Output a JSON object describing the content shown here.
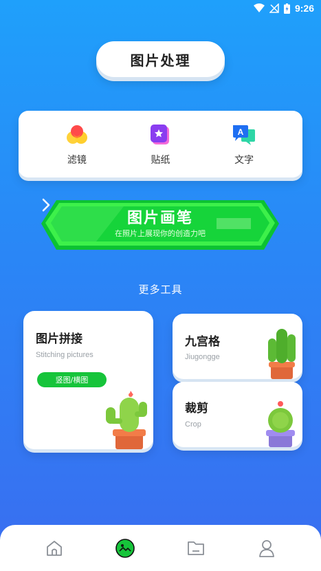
{
  "status": {
    "time": "9:26"
  },
  "header": {
    "title": "图片处理"
  },
  "tools": [
    {
      "label": "滤镜",
      "icon": "filter-icon"
    },
    {
      "label": "贴纸",
      "icon": "sticker-icon"
    },
    {
      "label": "文字",
      "icon": "text-icon"
    }
  ],
  "brush": {
    "title": "图片画笔",
    "subtitle": "在照片上展现你的创造力吧"
  },
  "more": {
    "label": "更多工具"
  },
  "cards": {
    "stitch": {
      "title": "图片拼接",
      "subtitle": "Stitching pictures",
      "badge": "竖图/横图"
    },
    "grid": {
      "title": "九宫格",
      "subtitle": "Jiugongge"
    },
    "crop": {
      "title": "裁剪",
      "subtitle": "Crop"
    }
  },
  "nav": [
    {
      "name": "home-icon",
      "active": false
    },
    {
      "name": "image-icon",
      "active": true
    },
    {
      "name": "folder-icon",
      "active": false
    },
    {
      "name": "profile-icon",
      "active": false
    }
  ],
  "colors": {
    "accent_green": "#16c43a",
    "bg_blue": "#2a86f6"
  }
}
